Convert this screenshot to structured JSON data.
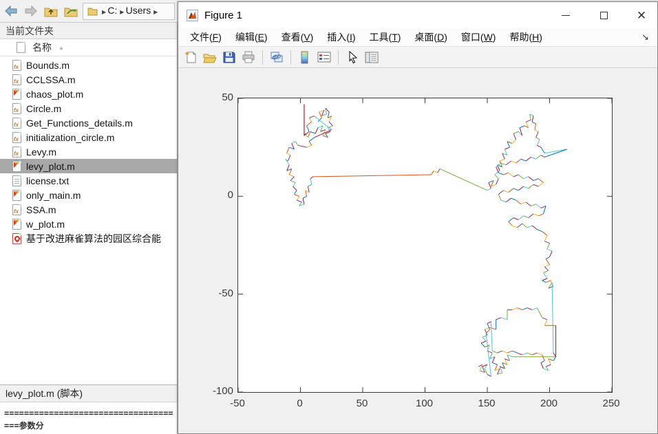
{
  "desktop_toolbar": {
    "breadcrumb": {
      "segments": [
        "C:",
        "Users"
      ]
    }
  },
  "file_panel": {
    "panel_title": "当前文件夹",
    "column_header": "名称",
    "files": [
      {
        "name": "Bounds.m",
        "type": "function",
        "selected": false
      },
      {
        "name": "CCLSSA.m",
        "type": "function",
        "selected": false
      },
      {
        "name": "chaos_plot.m",
        "type": "script",
        "selected": false
      },
      {
        "name": "Circle.m",
        "type": "function",
        "selected": false
      },
      {
        "name": "Get_Functions_details.m",
        "type": "function",
        "selected": false
      },
      {
        "name": "initialization_circle.m",
        "type": "function",
        "selected": false
      },
      {
        "name": "Levy.m",
        "type": "function",
        "selected": false
      },
      {
        "name": "levy_plot.m",
        "type": "script",
        "selected": true
      },
      {
        "name": "license.txt",
        "type": "text",
        "selected": false
      },
      {
        "name": "only_main.m",
        "type": "script",
        "selected": false
      },
      {
        "name": "SSA.m",
        "type": "function",
        "selected": false
      },
      {
        "name": "w_plot.m",
        "type": "script",
        "selected": false
      },
      {
        "name": "基于改进麻雀算法的园区综合能",
        "type": "pdf",
        "selected": false
      }
    ],
    "details_bar": "levy_plot.m (脚本)",
    "preview_lines": [
      "==================================",
      "===参数分"
    ]
  },
  "figure": {
    "title": "Figure 1",
    "menus": [
      {
        "label": "文件",
        "key": "F"
      },
      {
        "label": "编辑",
        "key": "E"
      },
      {
        "label": "查看",
        "key": "V"
      },
      {
        "label": "插入",
        "key": "I"
      },
      {
        "label": "工具",
        "key": "T"
      },
      {
        "label": "桌面",
        "key": "D"
      },
      {
        "label": "窗口",
        "key": "W"
      },
      {
        "label": "帮助",
        "key": "H"
      }
    ],
    "toolbar_icons": [
      "new-figure",
      "open-file",
      "save-figure",
      "print-figure",
      "link-plot",
      "insert-colorbar",
      "insert-legend",
      "edit-plot",
      "property-inspector"
    ]
  },
  "chart_data": {
    "type": "line",
    "title": "",
    "xlabel": "",
    "ylabel": "",
    "xlim": [
      -50,
      250
    ],
    "ylim": [
      -100,
      50
    ],
    "x_ticks": [
      -50,
      0,
      50,
      100,
      150,
      200,
      250
    ],
    "y_ticks": [
      50,
      0,
      -50,
      -100
    ],
    "x_tick_labels": [
      "-50",
      "0",
      "50",
      "100",
      "150",
      "200",
      "250"
    ],
    "y_tick_labels": [
      "50",
      "0",
      "-50",
      "-100"
    ],
    "grid": false,
    "legend": false,
    "description": "Levy flight 2-D random-walk trajectory; each step plotted as a separate segment cycling MATLAB default colors; three dense clusters connected by long jumps",
    "palette": [
      "#0072BD",
      "#D95319",
      "#EDB120",
      "#7E2F8E",
      "#77AC30",
      "#4DBEEE",
      "#A2142F"
    ],
    "long_segment_threshold": 15.5,
    "long_segment_colors": [
      "#A2142F",
      "#A2142F",
      "#D95319",
      "#77AC30",
      "#4DBEEE",
      "#0072BD",
      "#4DBEEE",
      "#A2142F",
      "#77AC30",
      "#4DBEEE"
    ],
    "trajectory": [
      [
        14,
        38
      ],
      [
        17,
        40
      ],
      [
        15,
        43
      ],
      [
        19,
        44
      ],
      [
        17,
        41
      ],
      [
        21,
        42
      ],
      [
        20,
        45
      ],
      [
        23,
        43
      ],
      [
        22,
        40
      ],
      [
        25,
        41
      ],
      [
        23,
        38
      ],
      [
        26,
        36
      ],
      [
        22,
        35
      ],
      [
        24,
        33
      ],
      [
        20,
        32
      ],
      [
        22,
        30
      ],
      [
        18,
        31
      ],
      [
        20,
        34
      ],
      [
        16,
        33
      ],
      [
        18,
        36
      ],
      [
        14,
        35
      ],
      [
        12,
        32
      ],
      [
        8,
        33
      ],
      [
        6,
        30
      ],
      [
        4,
        32
      ],
      [
        3,
        31
      ],
      [
        3,
        47
      ],
      [
        3,
        31
      ],
      [
        7,
        33
      ],
      [
        5,
        36
      ],
      [
        9,
        38
      ],
      [
        7,
        40
      ],
      [
        11,
        41
      ],
      [
        13,
        40
      ],
      [
        25,
        34
      ],
      [
        11,
        30
      ],
      [
        7,
        28
      ],
      [
        9,
        26
      ],
      [
        5,
        25
      ],
      [
        -2,
        26
      ],
      [
        -4,
        28
      ],
      [
        -7,
        27
      ],
      [
        -5,
        24
      ],
      [
        -9,
        25
      ],
      [
        -11,
        22
      ],
      [
        -8,
        21
      ],
      [
        -10,
        18
      ],
      [
        -12,
        19
      ],
      [
        -9,
        16
      ],
      [
        -11,
        13
      ],
      [
        -7,
        14
      ],
      [
        -9,
        11
      ],
      [
        -5,
        10
      ],
      [
        -8,
        8
      ],
      [
        -4,
        7
      ],
      [
        -6,
        5
      ],
      [
        -3,
        3
      ],
      [
        -5,
        1
      ],
      [
        -1,
        0
      ],
      [
        -3,
        -2
      ],
      [
        1,
        -3
      ],
      [
        -1,
        -5
      ],
      [
        3,
        -4
      ],
      [
        2,
        -1
      ],
      [
        5,
        0
      ],
      [
        4,
        3
      ],
      [
        7,
        2
      ],
      [
        6,
        5
      ],
      [
        9,
        6
      ],
      [
        8,
        9
      ],
      [
        10,
        10
      ],
      [
        105,
        11
      ],
      [
        107,
        13
      ],
      [
        110,
        12
      ],
      [
        112,
        14
      ],
      [
        150,
        3
      ],
      [
        153,
        4
      ],
      [
        151,
        7
      ],
      [
        155,
        8
      ],
      [
        153,
        5
      ],
      [
        157,
        6
      ],
      [
        159,
        9
      ],
      [
        156,
        11
      ],
      [
        160,
        13
      ],
      [
        158,
        16
      ],
      [
        162,
        15
      ],
      [
        160,
        18
      ],
      [
        164,
        19
      ],
      [
        162,
        22
      ],
      [
        166,
        21
      ],
      [
        164,
        24
      ],
      [
        168,
        25
      ],
      [
        166,
        28
      ],
      [
        170,
        27
      ],
      [
        173,
        29
      ],
      [
        171,
        32
      ],
      [
        175,
        33
      ],
      [
        178,
        31
      ],
      [
        176,
        35
      ],
      [
        180,
        36
      ],
      [
        183,
        35
      ],
      [
        181,
        38
      ],
      [
        185,
        39
      ],
      [
        184,
        42
      ],
      [
        187,
        41
      ],
      [
        186,
        38
      ],
      [
        189,
        37
      ],
      [
        188,
        34
      ],
      [
        191,
        33
      ],
      [
        189,
        30
      ],
      [
        192,
        29
      ],
      [
        190,
        26
      ],
      [
        193,
        25
      ],
      [
        196,
        22
      ],
      [
        214,
        24
      ],
      [
        196,
        20
      ],
      [
        193,
        21
      ],
      [
        189,
        19
      ],
      [
        185,
        20
      ],
      [
        181,
        18
      ],
      [
        177,
        19
      ],
      [
        173,
        17
      ],
      [
        169,
        18
      ],
      [
        165,
        16
      ],
      [
        161,
        17
      ],
      [
        157,
        15
      ],
      [
        159,
        12
      ],
      [
        163,
        11
      ],
      [
        167,
        12
      ],
      [
        171,
        10
      ],
      [
        175,
        11
      ],
      [
        179,
        9
      ],
      [
        183,
        10
      ],
      [
        187,
        8
      ],
      [
        191,
        9
      ],
      [
        195,
        7
      ],
      [
        191,
        5
      ],
      [
        187,
        6
      ],
      [
        183,
        4
      ],
      [
        179,
        5
      ],
      [
        175,
        3
      ],
      [
        171,
        4
      ],
      [
        167,
        2
      ],
      [
        163,
        3
      ],
      [
        159,
        1
      ],
      [
        161,
        -2
      ],
      [
        165,
        -3
      ],
      [
        169,
        -1
      ],
      [
        173,
        -2
      ],
      [
        177,
        -4
      ],
      [
        181,
        -3
      ],
      [
        185,
        -5
      ],
      [
        189,
        -4
      ],
      [
        193,
        -6
      ],
      [
        197,
        -5
      ],
      [
        195,
        -9
      ],
      [
        191,
        -10
      ],
      [
        187,
        -9
      ],
      [
        183,
        -11
      ],
      [
        179,
        -10
      ],
      [
        175,
        -12
      ],
      [
        171,
        -11
      ],
      [
        167,
        -13
      ],
      [
        170,
        -15
      ],
      [
        174,
        -16
      ],
      [
        178,
        -14
      ],
      [
        182,
        -16
      ],
      [
        186,
        -15
      ],
      [
        190,
        -17
      ],
      [
        194,
        -18
      ],
      [
        198,
        -20
      ],
      [
        196,
        -23
      ],
      [
        200,
        -24
      ],
      [
        198,
        -27
      ],
      [
        202,
        -28
      ],
      [
        200,
        -31
      ],
      [
        197,
        -32
      ],
      [
        200,
        -35
      ],
      [
        196,
        -36
      ],
      [
        199,
        -38
      ],
      [
        195,
        -39
      ],
      [
        198,
        -42
      ],
      [
        194,
        -43
      ],
      [
        197,
        -44
      ],
      [
        201,
        -43
      ],
      [
        203,
        -46
      ],
      [
        199,
        -47
      ],
      [
        202,
        -44
      ],
      [
        203,
        -80
      ],
      [
        205,
        -82
      ],
      [
        205,
        -66
      ],
      [
        196,
        -66
      ],
      [
        198,
        -63
      ],
      [
        194,
        -62
      ],
      [
        190,
        -57
      ],
      [
        186,
        -58
      ],
      [
        182,
        -57
      ],
      [
        178,
        -58
      ],
      [
        174,
        -57
      ],
      [
        170,
        -58
      ],
      [
        166,
        -58
      ],
      [
        166,
        -63
      ],
      [
        161,
        -62
      ],
      [
        157,
        -63
      ],
      [
        157,
        -68
      ],
      [
        152,
        -67
      ],
      [
        148,
        -68
      ],
      [
        150,
        -71
      ],
      [
        146,
        -72
      ],
      [
        149,
        -74
      ],
      [
        145,
        -75
      ],
      [
        148,
        -77
      ],
      [
        152,
        -76
      ],
      [
        150,
        -79
      ],
      [
        154,
        -80
      ],
      [
        152,
        -83
      ],
      [
        156,
        -82
      ],
      [
        154,
        -85
      ],
      [
        158,
        -86
      ],
      [
        156,
        -89
      ],
      [
        160,
        -88
      ],
      [
        158,
        -91
      ],
      [
        162,
        -90
      ],
      [
        160,
        -87
      ],
      [
        164,
        -88
      ],
      [
        162,
        -85
      ],
      [
        166,
        -86
      ],
      [
        164,
        -83
      ],
      [
        168,
        -84
      ],
      [
        166,
        -81
      ],
      [
        170,
        -82
      ],
      [
        205,
        -82
      ],
      [
        203,
        -84
      ],
      [
        199,
        -83
      ],
      [
        201,
        -86
      ],
      [
        197,
        -87
      ],
      [
        199,
        -89
      ],
      [
        195,
        -88
      ],
      [
        193,
        -85
      ],
      [
        196,
        -84
      ],
      [
        194,
        -81
      ],
      [
        190,
        -80
      ],
      [
        186,
        -81
      ],
      [
        182,
        -80
      ],
      [
        178,
        -81
      ],
      [
        174,
        -80
      ],
      [
        170,
        -79
      ],
      [
        166,
        -80
      ],
      [
        162,
        -79
      ],
      [
        158,
        -80
      ],
      [
        154,
        -79
      ],
      [
        153,
        -64
      ],
      [
        150,
        -65
      ],
      [
        152,
        -68
      ],
      [
        149,
        -70
      ],
      [
        153,
        -92
      ],
      [
        150,
        -91
      ],
      [
        148,
        -88
      ],
      [
        150,
        -86
      ],
      [
        146,
        -87
      ],
      [
        148,
        -90
      ],
      [
        144,
        -89
      ],
      [
        146,
        -86
      ],
      [
        143,
        -87
      ]
    ]
  }
}
